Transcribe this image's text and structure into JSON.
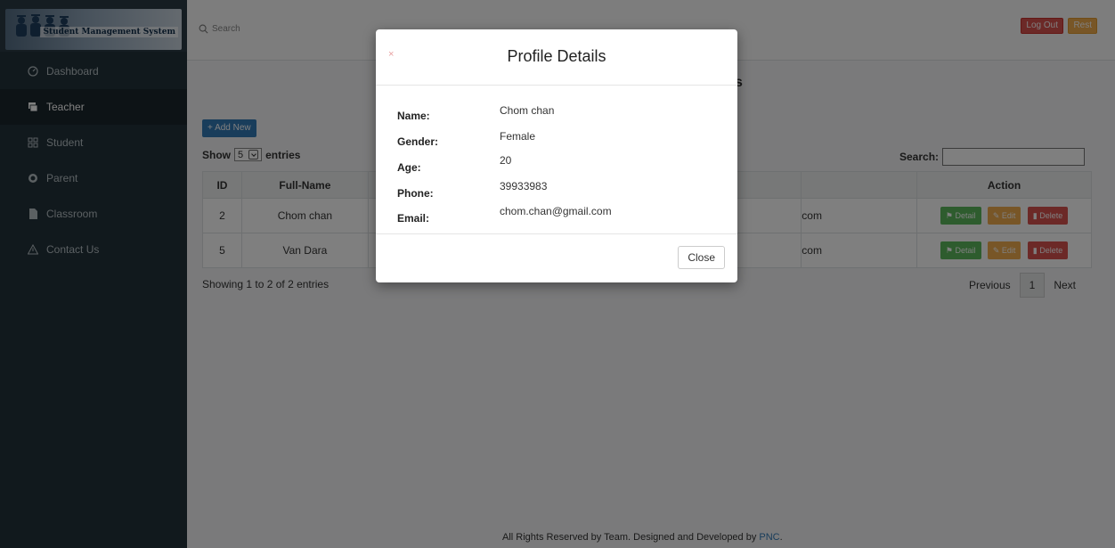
{
  "brand": {
    "name": "Student Management System"
  },
  "sidebar": {
    "items": [
      {
        "label": "Dashboard",
        "icon": "dashboard-icon"
      },
      {
        "label": "Teacher",
        "icon": "teacher-icon",
        "active": true
      },
      {
        "label": "Student",
        "icon": "student-icon"
      },
      {
        "label": "Parent",
        "icon": "parent-icon"
      },
      {
        "label": "Classroom",
        "icon": "classroom-icon"
      },
      {
        "label": "Contact Us",
        "icon": "warning-icon"
      }
    ]
  },
  "topbar": {
    "search_placeholder": "Search",
    "logout_label": "Log Out",
    "rest_label": "Rest"
  },
  "main": {
    "heading_fragment": "s",
    "add_new_label": "+ Add New",
    "show_label": "Show",
    "entries_select": "5",
    "entries_label": "entries",
    "search_label": "Search:",
    "columns": {
      "id": "ID",
      "fullname": "Full-Name",
      "action": "Action"
    },
    "rows": [
      {
        "id": "2",
        "fullname": "Chom chan",
        "email_fragment": "com"
      },
      {
        "id": "5",
        "fullname": "Van Dara",
        "email_fragment": "com"
      }
    ],
    "action_labels": {
      "detail": "Detail",
      "edit": "Edit",
      "delete": "Delete"
    },
    "showing_info": "Showing 1 to 2 of 2 entries",
    "pager": {
      "previous": "Previous",
      "current": "1",
      "next": "Next"
    }
  },
  "footer": {
    "text": "All Rights Reserved by Team. Designed and Developed by ",
    "link": "PNC",
    "suffix": "."
  },
  "modal": {
    "close_x": "×",
    "title": "Profile Details",
    "fields": [
      {
        "key": "Name:",
        "value": "Chom chan"
      },
      {
        "key": "Gender:",
        "value": "Female"
      },
      {
        "key": "Age:",
        "value": "20"
      },
      {
        "key": "Phone:",
        "value": "39933983"
      },
      {
        "key": "Email:",
        "value": "chom.chan@gmail.com"
      }
    ],
    "close_button": "Close"
  },
  "colors": {
    "sidebar_bg": "#23323b",
    "primary": "#337ab7",
    "danger": "#d9534f",
    "warning": "#f0ad4e",
    "success": "#5cb85c"
  }
}
